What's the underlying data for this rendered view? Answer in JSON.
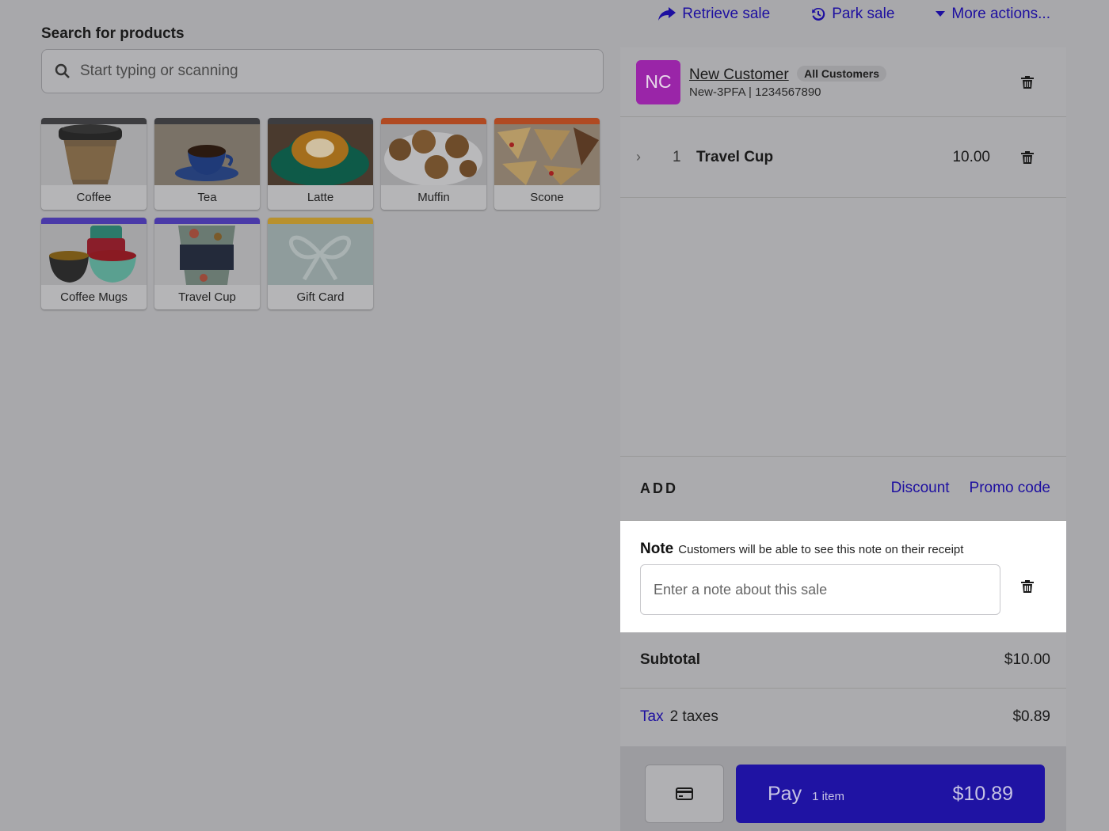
{
  "topbar": {
    "retrieve_label": "Retrieve sale",
    "park_label": "Park sale",
    "more_label": "More actions..."
  },
  "search": {
    "label": "Search for products",
    "placeholder": "Start typing or scanning"
  },
  "products": [
    {
      "label": "Coffee",
      "strip": "#3d3d40"
    },
    {
      "label": "Tea",
      "strip": "#3d3d40"
    },
    {
      "label": "Latte",
      "strip": "#3d3d40"
    },
    {
      "label": "Muffin",
      "strip": "#b04a22"
    },
    {
      "label": "Scone",
      "strip": "#b04a22"
    },
    {
      "label": "Coffee Mugs",
      "strip": "#4a3aa8"
    },
    {
      "label": "Travel Cup",
      "strip": "#4a3aa8"
    },
    {
      "label": "Gift Card",
      "strip": "#b8912e"
    }
  ],
  "customer": {
    "initials": "NC",
    "name": "New Customer",
    "group": "All Customers",
    "code": "New-3PFA | 1234567890"
  },
  "line_items": [
    {
      "qty": "1",
      "name": "Travel Cup",
      "price": "10.00"
    }
  ],
  "add": {
    "title": "ADD",
    "discount": "Discount",
    "promo": "Promo code"
  },
  "note": {
    "title": "Note",
    "hint": "Customers will be able to see this note on their receipt",
    "placeholder": "Enter a note about this sale"
  },
  "totals": {
    "subtotal_label": "Subtotal",
    "subtotal": "$10.00",
    "tax_label": "Tax",
    "tax_count": "2 taxes",
    "tax": "$0.89"
  },
  "pay": {
    "label": "Pay",
    "count": "1 item",
    "amount": "$10.89"
  },
  "colors": {
    "accent": "#1f13a3",
    "avatar": "#9a25a8",
    "overlay_bg": "#a8a8ab"
  }
}
